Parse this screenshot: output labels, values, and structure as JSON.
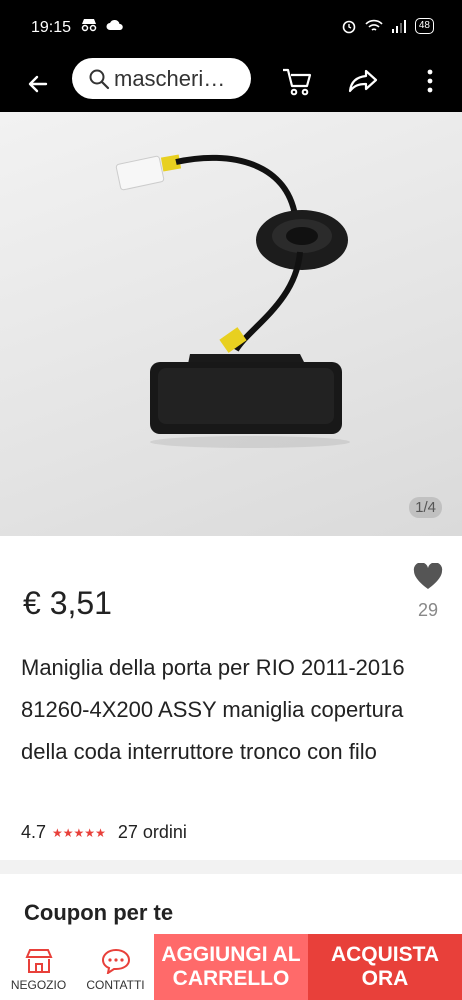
{
  "status_bar": {
    "time": "19:15",
    "battery": "48"
  },
  "nav": {
    "search_text": "mascheri…"
  },
  "product": {
    "image_counter": "1/4",
    "price": "€ 3,51",
    "wish_count": "29",
    "title": "Maniglia della porta per RIO 2011-2016 81260-4X200 ASSY maniglia copertura della coda interruttore tronco con filo",
    "rating": "4.7",
    "stars": "★★★★★",
    "orders": "27 ordini"
  },
  "coupon": {
    "title": "Coupon per te"
  },
  "bottom_bar": {
    "store_label": "NEGOZIO",
    "contacts_label": "CONTATTI",
    "add_to_cart_label": "AGGIUNGI AL CARRELLO",
    "buy_now_label": "ACQUISTA ORA"
  },
  "colors": {
    "accent": "#e8403a",
    "add_cart": "#ff6a6a"
  }
}
